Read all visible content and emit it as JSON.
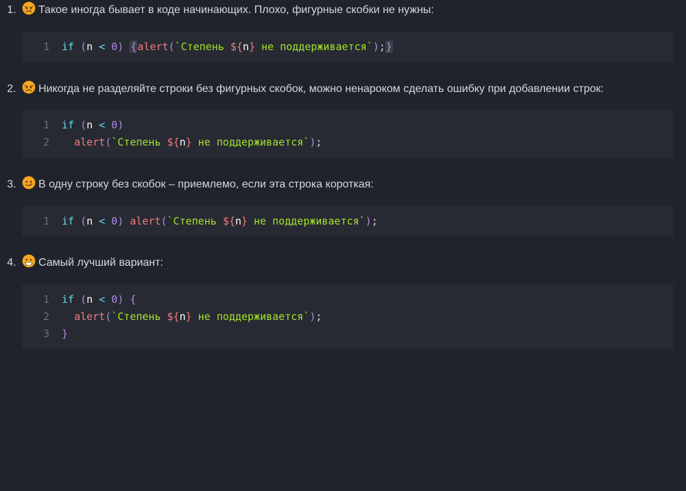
{
  "items": [
    {
      "emoji": "angry",
      "text": "Такое иногда бывает в коде начинающих. Плохо, фигурные скобки не нужны:",
      "code": {
        "lines": [
          {
            "num": "1",
            "tokens": [
              {
                "c": "kw",
                "t": "if"
              },
              {
                "c": "punc",
                "t": " "
              },
              {
                "c": "brkt",
                "t": "("
              },
              {
                "c": "var",
                "t": "n"
              },
              {
                "c": "punc",
                "t": " "
              },
              {
                "c": "op",
                "t": "<"
              },
              {
                "c": "punc",
                "t": " "
              },
              {
                "c": "num",
                "t": "0"
              },
              {
                "c": "brkt",
                "t": ")"
              },
              {
                "c": "punc",
                "t": " "
              },
              {
                "c": "brkt hlbg",
                "t": "{"
              },
              {
                "c": "call",
                "t": "alert"
              },
              {
                "c": "brkt",
                "t": "("
              },
              {
                "c": "str",
                "t": "`Степень "
              },
              {
                "c": "tplp",
                "t": "${"
              },
              {
                "c": "var",
                "t": "n"
              },
              {
                "c": "tplp",
                "t": "}"
              },
              {
                "c": "str",
                "t": " не поддерживается`"
              },
              {
                "c": "brkt",
                "t": ")"
              },
              {
                "c": "punc",
                "t": ";"
              },
              {
                "c": "brkt hlbg",
                "t": "}"
              }
            ]
          }
        ]
      }
    },
    {
      "emoji": "angry",
      "text": "Никогда не разделяйте строки без фигурных скобок, можно ненароком сделать ошибку при добавлении строк:",
      "code": {
        "lines": [
          {
            "num": "1",
            "tokens": [
              {
                "c": "kw",
                "t": "if"
              },
              {
                "c": "punc",
                "t": " "
              },
              {
                "c": "brkt",
                "t": "("
              },
              {
                "c": "var",
                "t": "n"
              },
              {
                "c": "punc",
                "t": " "
              },
              {
                "c": "op",
                "t": "<"
              },
              {
                "c": "punc",
                "t": " "
              },
              {
                "c": "num",
                "t": "0"
              },
              {
                "c": "brkt",
                "t": ")"
              }
            ]
          },
          {
            "num": "2",
            "tokens": [
              {
                "c": "punc",
                "t": "  "
              },
              {
                "c": "call",
                "t": "alert"
              },
              {
                "c": "brkt",
                "t": "("
              },
              {
                "c": "str",
                "t": "`Степень "
              },
              {
                "c": "tplp",
                "t": "${"
              },
              {
                "c": "var",
                "t": "n"
              },
              {
                "c": "tplp",
                "t": "}"
              },
              {
                "c": "str",
                "t": " не поддерживается`"
              },
              {
                "c": "brkt",
                "t": ")"
              },
              {
                "c": "punc",
                "t": ";"
              }
            ]
          }
        ]
      }
    },
    {
      "emoji": "smirk",
      "text": "В одну строку без скобок – приемлемо, если эта строка короткая:",
      "code": {
        "lines": [
          {
            "num": "1",
            "tokens": [
              {
                "c": "kw",
                "t": "if"
              },
              {
                "c": "punc",
                "t": " "
              },
              {
                "c": "brkt",
                "t": "("
              },
              {
                "c": "var",
                "t": "n"
              },
              {
                "c": "punc",
                "t": " "
              },
              {
                "c": "op",
                "t": "<"
              },
              {
                "c": "punc",
                "t": " "
              },
              {
                "c": "num",
                "t": "0"
              },
              {
                "c": "brkt",
                "t": ")"
              },
              {
                "c": "punc",
                "t": " "
              },
              {
                "c": "call",
                "t": "alert"
              },
              {
                "c": "brkt",
                "t": "("
              },
              {
                "c": "str",
                "t": "`Степень "
              },
              {
                "c": "tplp",
                "t": "${"
              },
              {
                "c": "var",
                "t": "n"
              },
              {
                "c": "tplp",
                "t": "}"
              },
              {
                "c": "str",
                "t": " не поддерживается`"
              },
              {
                "c": "brkt",
                "t": ")"
              },
              {
                "c": "punc",
                "t": ";"
              }
            ]
          }
        ]
      }
    },
    {
      "emoji": "grin",
      "text": "Самый лучший вариант:",
      "code": {
        "lines": [
          {
            "num": "1",
            "tokens": [
              {
                "c": "kw",
                "t": "if"
              },
              {
                "c": "punc",
                "t": " "
              },
              {
                "c": "brkt",
                "t": "("
              },
              {
                "c": "var",
                "t": "n"
              },
              {
                "c": "punc",
                "t": " "
              },
              {
                "c": "op",
                "t": "<"
              },
              {
                "c": "punc",
                "t": " "
              },
              {
                "c": "num",
                "t": "0"
              },
              {
                "c": "brkt",
                "t": ")"
              },
              {
                "c": "punc",
                "t": " "
              },
              {
                "c": "brkt",
                "t": "{"
              }
            ]
          },
          {
            "num": "2",
            "tokens": [
              {
                "c": "punc",
                "t": "  "
              },
              {
                "c": "call",
                "t": "alert"
              },
              {
                "c": "brkt",
                "t": "("
              },
              {
                "c": "str",
                "t": "`Степень "
              },
              {
                "c": "tplp",
                "t": "${"
              },
              {
                "c": "var",
                "t": "n"
              },
              {
                "c": "tplp",
                "t": "}"
              },
              {
                "c": "str",
                "t": " не поддерживается`"
              },
              {
                "c": "brkt",
                "t": ")"
              },
              {
                "c": "punc",
                "t": ";"
              }
            ]
          },
          {
            "num": "3",
            "tokens": [
              {
                "c": "brkt",
                "t": "}"
              }
            ]
          }
        ]
      }
    }
  ]
}
